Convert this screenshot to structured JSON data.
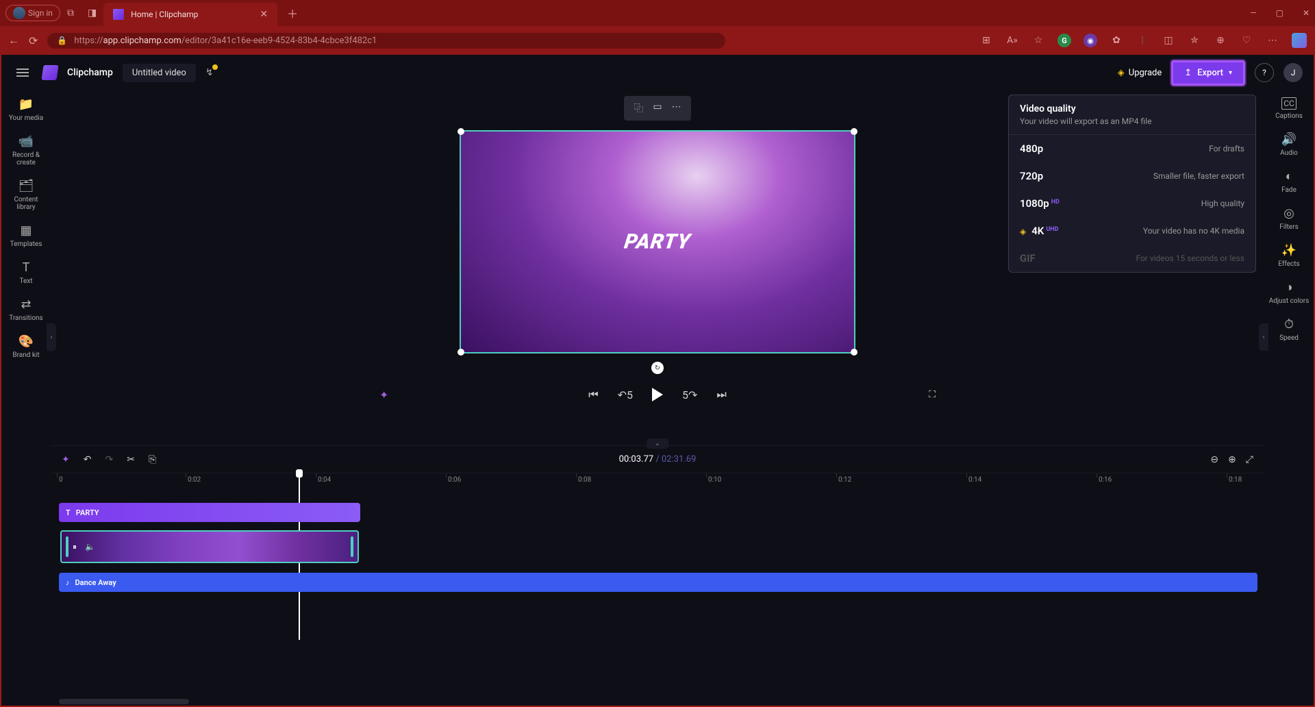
{
  "browser": {
    "signin": "Sign in",
    "tab_title": "Home | Clipchamp",
    "url_prefix": "https://",
    "url_host": "app.clipchamp.com",
    "url_path": "/editor/3a41c16e-eeb9-4524-83b4-4cbce3f482c1"
  },
  "header": {
    "brand": "Clipchamp",
    "project_title": "Untitled video",
    "upgrade": "Upgrade",
    "export": "Export",
    "help": "?",
    "user_initial": "J"
  },
  "left_sidebar": {
    "items": [
      {
        "icon": "📁",
        "label": "Your media"
      },
      {
        "icon": "📹",
        "label": "Record & create"
      },
      {
        "icon": "🗂",
        "label": "Content library"
      },
      {
        "icon": "▦",
        "label": "Templates"
      },
      {
        "icon": "T",
        "label": "Text"
      },
      {
        "icon": "⇄",
        "label": "Transitions"
      },
      {
        "icon": "🎨",
        "label": "Brand kit"
      }
    ]
  },
  "right_sidebar": {
    "items": [
      {
        "icon": "CC",
        "label": "Captions"
      },
      {
        "icon": "🔊",
        "label": "Audio"
      },
      {
        "icon": "◐",
        "label": "Fade"
      },
      {
        "icon": "◎",
        "label": "Filters"
      },
      {
        "icon": "✨",
        "label": "Effects"
      },
      {
        "icon": "◑",
        "label": "Adjust colors"
      },
      {
        "icon": "⏱",
        "label": "Speed"
      }
    ]
  },
  "preview": {
    "overlay_text": "PARTY"
  },
  "playback": {
    "current_time": "00:03.77",
    "duration": "02:31.69"
  },
  "ruler": {
    "ticks": [
      "0",
      "0:02",
      "0:04",
      "0:06",
      "0:08",
      "0:10",
      "0:12",
      "0:14",
      "0:16",
      "0:18"
    ]
  },
  "tracks": {
    "text_clip_label": "PARTY",
    "audio_clip_label": "Dance Away"
  },
  "export_menu": {
    "title": "Video quality",
    "subtitle": "Your video will export as an MP4 file",
    "options": [
      {
        "label": "480p",
        "badge": "",
        "desc": "For drafts",
        "premium": false,
        "disabled": false
      },
      {
        "label": "720p",
        "badge": "",
        "desc": "Smaller file, faster export",
        "premium": false,
        "disabled": false
      },
      {
        "label": "1080p",
        "badge": "HD",
        "desc": "High quality",
        "premium": false,
        "disabled": false
      },
      {
        "label": "4K",
        "badge": "UHD",
        "desc": "Your video has no 4K media",
        "premium": true,
        "disabled": false
      },
      {
        "label": "GIF",
        "badge": "",
        "desc": "For videos 15 seconds or less",
        "premium": false,
        "disabled": true
      }
    ]
  }
}
